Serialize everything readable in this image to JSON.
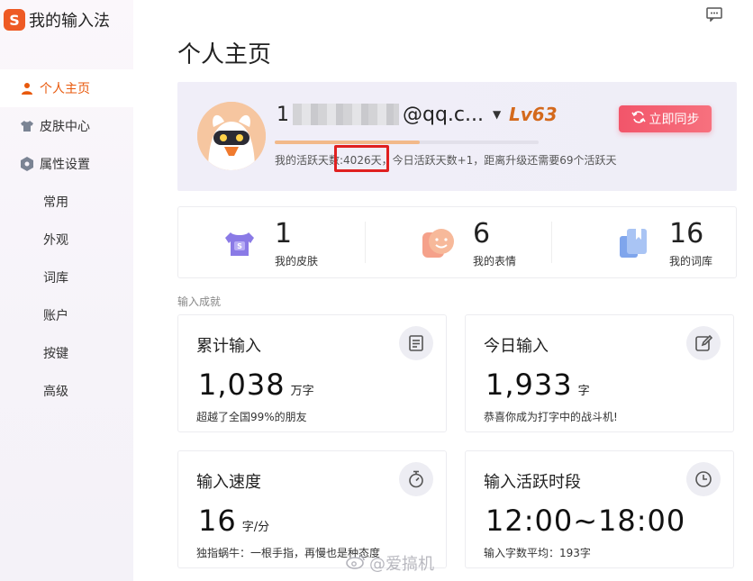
{
  "app": {
    "title": "我的输入法",
    "logo_letter": "S"
  },
  "sidebar": {
    "items": [
      {
        "label": "个人主页",
        "icon": "user-icon",
        "active": true
      },
      {
        "label": "皮肤中心",
        "icon": "shirt-icon",
        "active": false
      },
      {
        "label": "属性设置",
        "icon": "hexagon-gear-icon",
        "active": false
      }
    ],
    "subitems": [
      "常用",
      "外观",
      "词库",
      "账户",
      "按键",
      "高级"
    ]
  },
  "page": {
    "title": "个人主页"
  },
  "profile": {
    "account_prefix": "1",
    "account_suffix": "@qq.c...",
    "level": "Lv63",
    "progress": 0.55,
    "active_text": "我的活跃天数:4026天，今日活跃天数+1，距离升级还需要69个活跃天",
    "sync_label": "立即同步"
  },
  "stats": [
    {
      "value": "1",
      "label": "我的皮肤",
      "icon": "skin-icon"
    },
    {
      "value": "6",
      "label": "我的表情",
      "icon": "emoji-icon"
    },
    {
      "value": "16",
      "label": "我的词库",
      "icon": "dictionary-icon"
    }
  ],
  "section": {
    "label": "输入成就"
  },
  "cards": [
    {
      "title": "累计输入",
      "value": "1,038",
      "unit": "万字",
      "note": "超越了全国99%的朋友",
      "icon": "document-icon"
    },
    {
      "title": "今日输入",
      "value": "1,933",
      "unit": "字",
      "note": "恭喜你成为打字中的战斗机!",
      "icon": "edit-icon"
    },
    {
      "title": "输入速度",
      "value": "16",
      "unit": "字/分",
      "note": "独指蜗牛：一根手指，再慢也是种态度",
      "icon": "stopwatch-icon"
    },
    {
      "title": "输入活跃时段",
      "value": "12:00~18:00",
      "unit": "",
      "note": "输入字数平均：193字",
      "icon": "clock-icon"
    }
  ],
  "watermark": "@爱搞机",
  "colors": {
    "accent": "#e8590c",
    "sync": "#f2556a",
    "level": "#d4691c",
    "highlight": "#e02020"
  }
}
